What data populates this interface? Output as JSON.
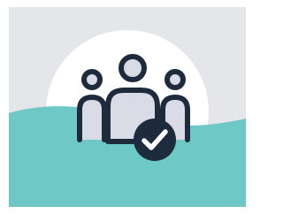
{
  "illustration": {
    "icon": "group-verified-icon",
    "badge_icon": "checkmark-icon",
    "colors": {
      "background": "#e5e6ea",
      "sun": "#ffffff",
      "water": "#6ec8c5",
      "outline": "#1d2b3d",
      "figure_fill": "#d9dce6",
      "badge_fill": "#1d2b3d",
      "check": "#ffffff"
    }
  }
}
